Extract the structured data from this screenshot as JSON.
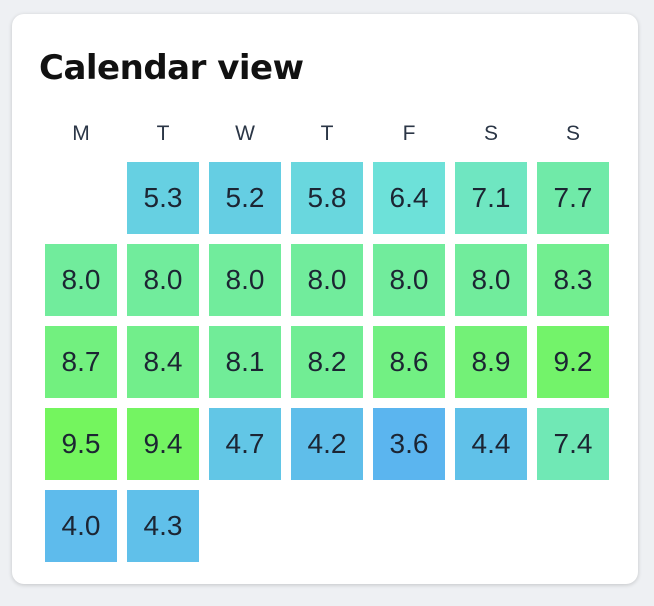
{
  "card": {
    "title": "Calendar view"
  },
  "calendar": {
    "weekdays": [
      "M",
      "T",
      "W",
      "T",
      "F",
      "S",
      "S"
    ],
    "first_day_offset": 1,
    "values": [
      5.3,
      5.2,
      5.8,
      6.4,
      7.1,
      7.7,
      8.0,
      8.0,
      8.0,
      8.0,
      8.0,
      8.0,
      8.3,
      8.7,
      8.4,
      8.1,
      8.2,
      8.6,
      8.9,
      9.2,
      9.5,
      9.4,
      4.7,
      4.2,
      3.6,
      4.4,
      7.4,
      4.0,
      4.3
    ],
    "labels": [
      "5.3",
      "5.2",
      "5.8",
      "6.4",
      "7.1",
      "7.7",
      "8.0",
      "8.0",
      "8.0",
      "8.0",
      "8.0",
      "8.0",
      "8.3",
      "8.7",
      "8.4",
      "8.1",
      "8.2",
      "8.6",
      "8.9",
      "9.2",
      "9.5",
      "9.4",
      "4.7",
      "4.2",
      "3.6",
      "4.4",
      "7.4",
      "4.0",
      "4.3"
    ],
    "color_scale": {
      "low_value": 3.6,
      "high_value": 9.5,
      "low_color": "#5bb5ef",
      "mid_color": "#6ee3d8",
      "high_color": "#74f55e"
    }
  }
}
